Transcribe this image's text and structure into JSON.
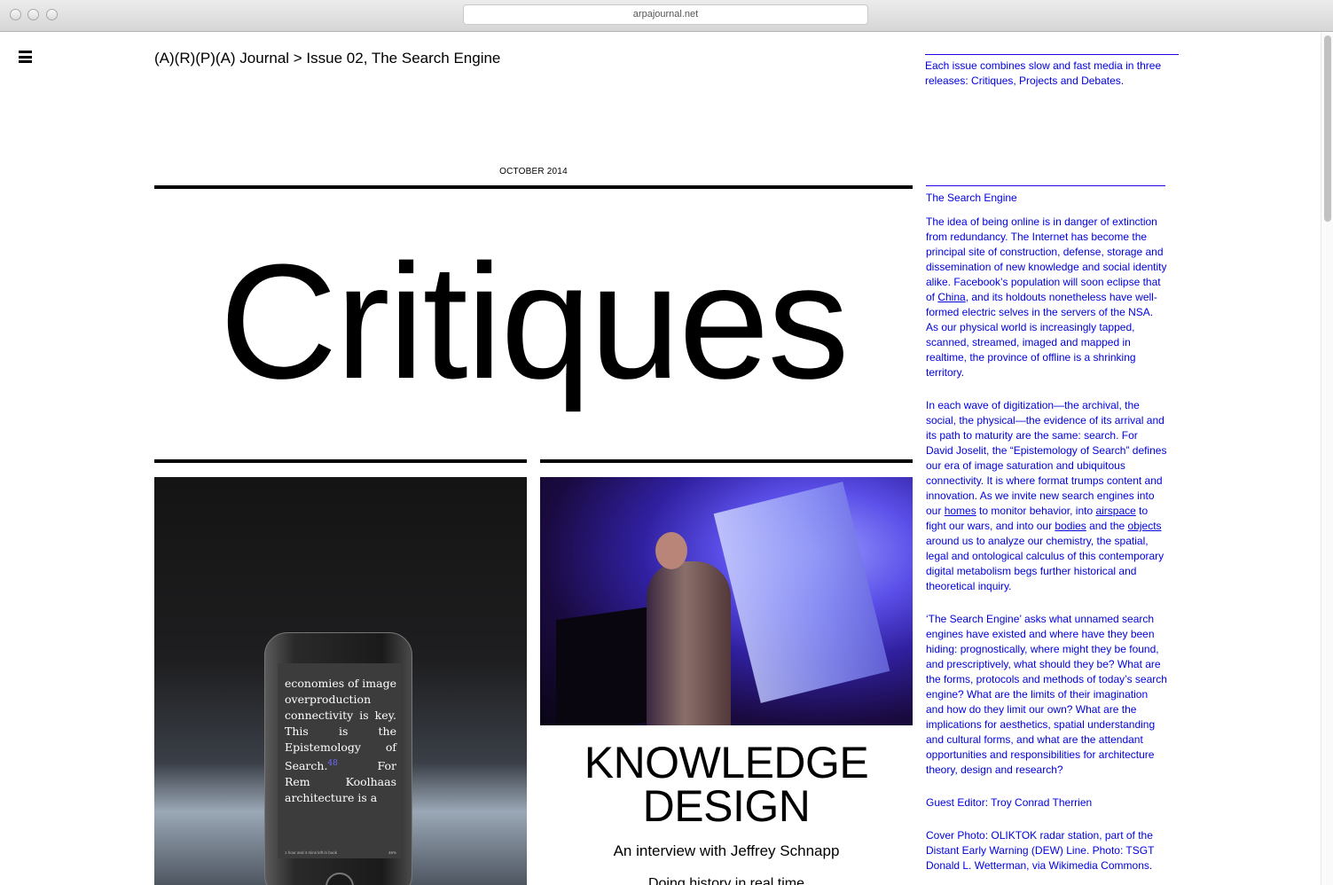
{
  "browser": {
    "url": "arpajournal.net"
  },
  "header": {
    "breadcrumb": "(A)(R)(P)(A) Journal > Issue 02, The Search Engine",
    "intro": "Each issue combines slow and fast media in three releases: Critiques, Projects and Debates."
  },
  "main": {
    "date": "OCTOBER 2014",
    "title": "Critiques",
    "phone_excerpt": {
      "text": "economies of image overproduction connectivity is key. This is the Epistemology of Search.",
      "footnote": "48",
      "continuation": "For Rem Koolhaas architecture is a",
      "status": "1 hour and 4 mins left in book",
      "percent": "46%"
    },
    "article": {
      "title_line1": "KNOWLEDGE",
      "title_line2": "DESIGN",
      "subtitle": "An interview with Jeffrey Schnapp",
      "tagline": "Doing history in real time"
    }
  },
  "sidebar": {
    "heading": "The Search Engine",
    "p1_a": "The idea of being online is in danger of extinction from redundancy. The Internet has become the principal site of construction, defense, storage and dissemination of new knowledge and social identity alike. Facebook’s population will soon eclipse that of ",
    "p1_link": "China",
    "p1_b": ", and its holdouts nonetheless have well-formed electric selves in the servers of the NSA. As our physical world is increasingly tapped, scanned, streamed, imaged and mapped in realtime, the province of offline is a shrinking territory.",
    "p2_a": "In each wave of digitization—the archival, the social, the physical—the evidence of its arrival and its path to maturity are the same: search. For David Joselit, the “Epistemology of Search” defines our era of image saturation and ubiquitous connectivity. It is where format trumps content and innovation. As we invite new search engines into our ",
    "p2_link1": "homes",
    "p2_b": " to monitor behavior, into ",
    "p2_link2": "airspace",
    "p2_c": " to fight our wars, and into our ",
    "p2_link3": "bodies",
    "p2_d": " and the ",
    "p2_link4": "objects",
    "p2_e": " around us to analyze our chemistry, the spatial, legal and ontological calculus of this contemporary digital metabolism begs further historical and theoretical inquiry.",
    "p3": "‘The Search Engine’ asks what unnamed search engines have existed and where have they been hiding: prognostically, where might they be found, and prescriptively, what should they be? What are the forms, protocols and methods of today’s search engine? What are the limits of their imagination and how do they limit our own? What are the implications for aesthetics, spatial understanding and cultural forms, and what are the attendant opportunities and responsibilities for architecture theory, design and research?",
    "guest_editor": "Guest Editor: Troy Conrad Therrien",
    "cover_photo": "Cover Photo: OLIKTOK radar station, part of the Distant Early Warning (DEW) Line. Photo: TSGT Donald L. Wetterman, via Wikimedia Commons."
  },
  "colors": {
    "link": "#0000e0",
    "text": "#000000",
    "background": "#ffffff"
  }
}
